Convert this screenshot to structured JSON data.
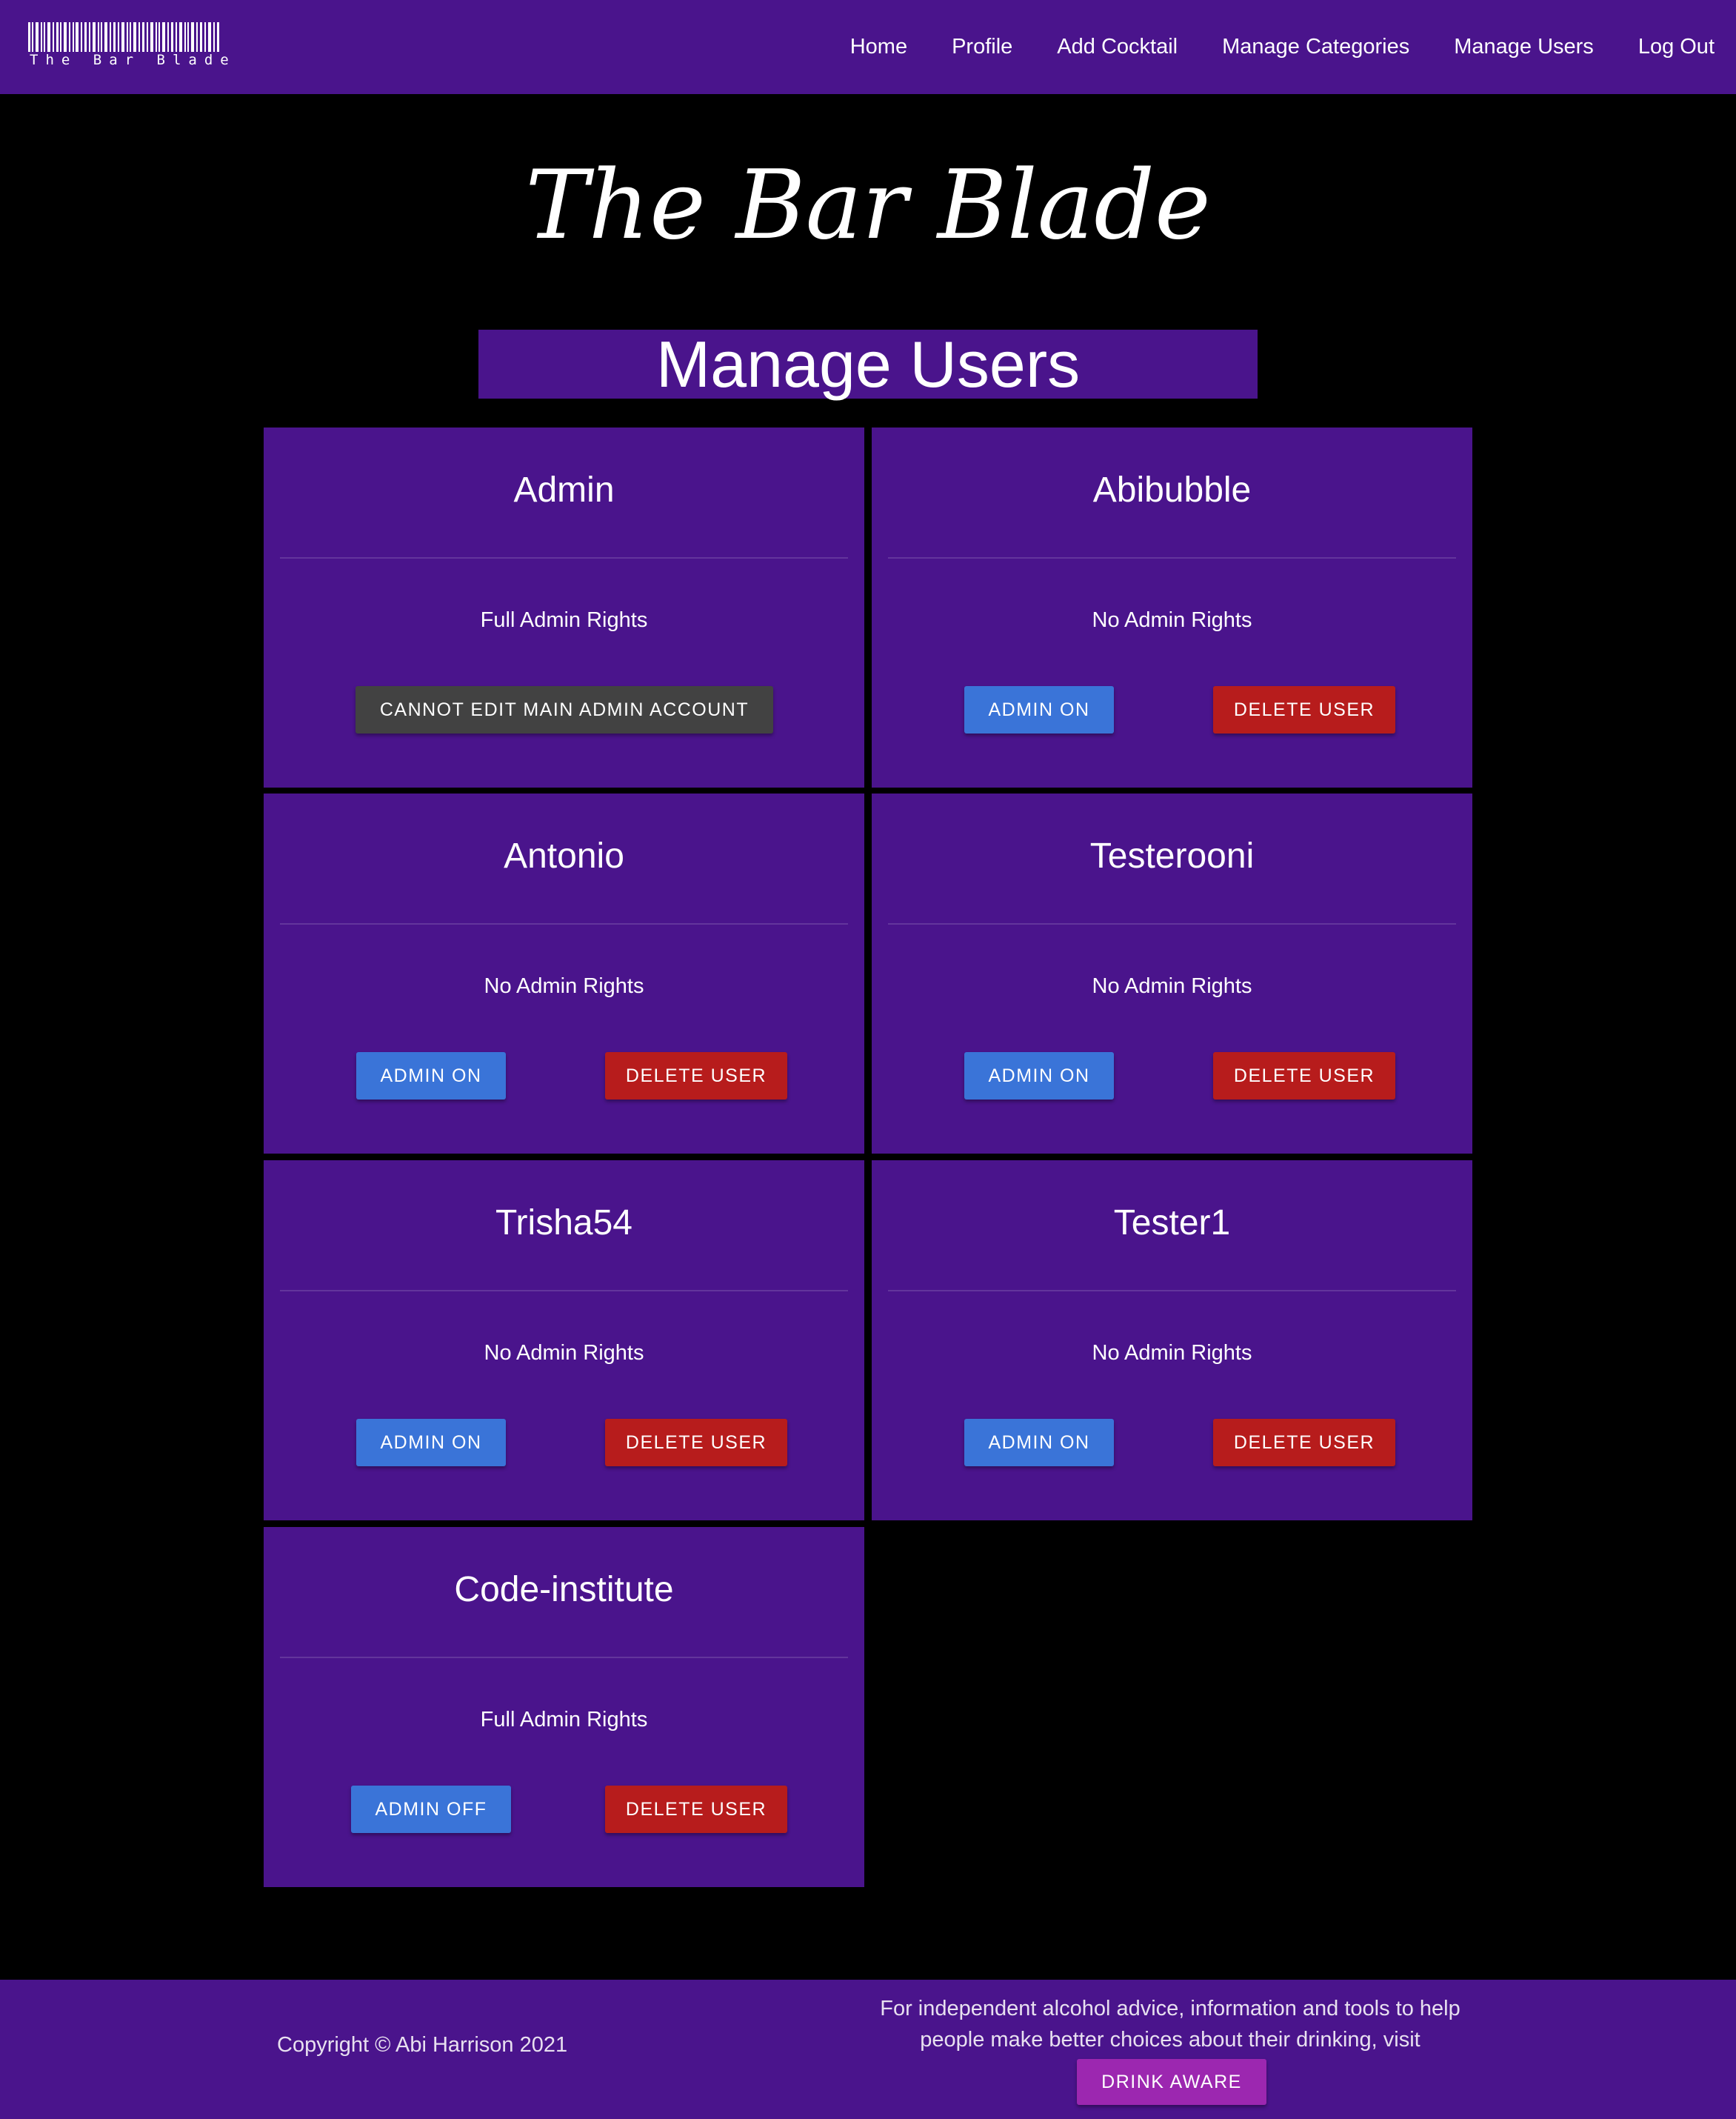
{
  "nav": {
    "logo_text": "The Bar Blade",
    "links": [
      "Home",
      "Profile",
      "Add Cocktail",
      "Manage Categories",
      "Manage Users",
      "Log Out"
    ]
  },
  "brand_title": "The Bar Blade",
  "page_title": "Manage Users",
  "users": [
    {
      "name": "Admin",
      "rights": "Full Admin Rights",
      "locked_label": "CANNOT EDIT MAIN ADMIN ACCOUNT"
    },
    {
      "name": "Abibubble",
      "rights": "No Admin Rights",
      "toggle_label": "ADMIN ON",
      "delete_label": "DELETE USER"
    },
    {
      "name": "Antonio",
      "rights": "No Admin Rights",
      "toggle_label": "ADMIN ON",
      "delete_label": "DELETE USER"
    },
    {
      "name": "Testerooni",
      "rights": "No Admin Rights",
      "toggle_label": "ADMIN ON",
      "delete_label": "DELETE USER"
    },
    {
      "name": "Trisha54",
      "rights": "No Admin Rights",
      "toggle_label": "ADMIN ON",
      "delete_label": "DELETE USER"
    },
    {
      "name": "Tester1",
      "rights": "No Admin Rights",
      "toggle_label": "ADMIN ON",
      "delete_label": "DELETE USER"
    },
    {
      "name": "Code-institute",
      "rights": "Full Admin Rights",
      "toggle_label": "ADMIN OFF",
      "delete_label": "DELETE USER"
    }
  ],
  "footer": {
    "copyright": "Copyright © Abi Harrison 2021",
    "advice": "For independent alcohol advice, information and tools to help people make better choices about their drinking, visit",
    "drink_aware_label": "DRINK AWARE"
  },
  "colors": {
    "primary": "#4a148c",
    "background": "#000000",
    "admin_toggle": "#3a74d8",
    "delete": "#b71c1c",
    "locked": "#424242",
    "drink_aware": "#9c27b0"
  }
}
